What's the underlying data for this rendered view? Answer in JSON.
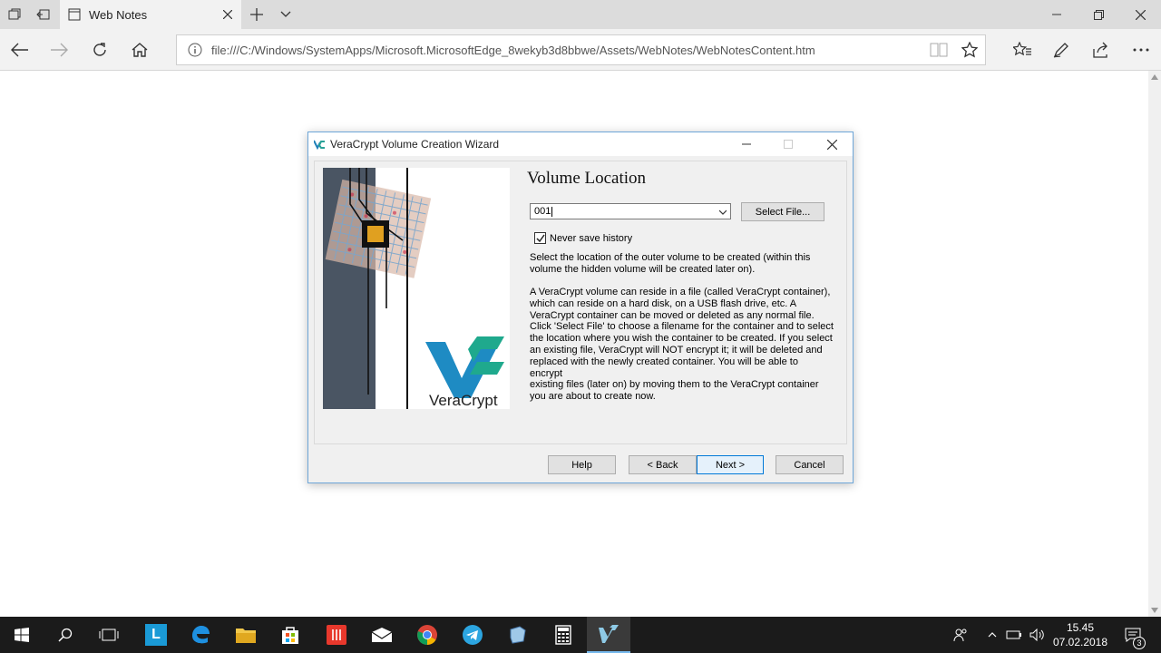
{
  "browser": {
    "tab_title": "Web Notes",
    "url": "file:///C:/Windows/SystemApps/Microsoft.MicrosoftEdge_8wekyb3d8bbwe/Assets/WebNotes/WebNotesContent.htm"
  },
  "dialog": {
    "title": "VeraCrypt Volume Creation Wizard",
    "heading": "Volume Location",
    "combo_value": "001",
    "select_file_label": "Select File...",
    "never_save_history_label": "Never save history",
    "never_save_history_checked": true,
    "paragraph1": "Select the location of the outer volume to be created (within this\nvolume the hidden volume will be created later on).",
    "paragraph2": "A VeraCrypt volume can reside in a file (called VeraCrypt container),\nwhich can reside on a hard disk, on a USB flash drive, etc. A\nVeraCrypt container can be moved or deleted as any normal file.\nClick 'Select File' to choose a filename for the container and to select\nthe location where you wish the container to be created. If you select\nan existing file, VeraCrypt will NOT encrypt it; it will be deleted and\nreplaced with the newly created container. You will be able to encrypt\nexisting files (later on) by moving them to the VeraCrypt container\nyou are about to create now.",
    "logo_text": "VeraCrypt",
    "buttons": {
      "help": "Help",
      "back": "< Back",
      "next": "Next >",
      "cancel": "Cancel"
    }
  },
  "taskbar": {
    "time": "15.45",
    "date": "07.02.2018",
    "notification_count": "3",
    "app_l_letter": "L"
  },
  "colors": {
    "accent": "#0078d7",
    "dialog_border": "#6ea6d8",
    "taskbar": "#1b1b1b"
  }
}
